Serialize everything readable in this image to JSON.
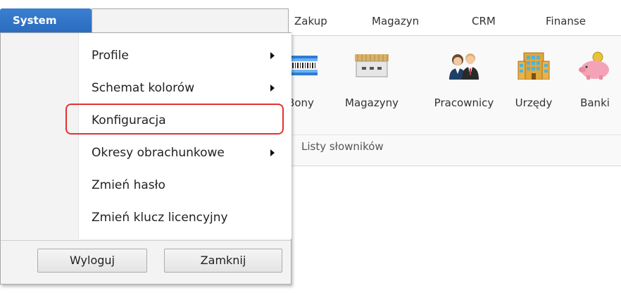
{
  "tabs": [
    {
      "label": "Zakup"
    },
    {
      "label": "Magazyn"
    },
    {
      "label": "CRM"
    },
    {
      "label": "Finanse"
    }
  ],
  "system_tab": {
    "label": "System"
  },
  "menu": {
    "items": [
      {
        "label": "Profile",
        "submenu": true
      },
      {
        "label": "Schemat kolorów",
        "submenu": true
      },
      {
        "label": "Konfiguracja",
        "submenu": false,
        "highlighted": true
      },
      {
        "label": "Okresy obrachunkowe",
        "submenu": true
      },
      {
        "label": "Zmień hasło",
        "submenu": false
      },
      {
        "label": "Zmień klucz licencyjny",
        "submenu": false
      }
    ],
    "logout_label": "Wyloguj",
    "close_label": "Zamknij"
  },
  "ribbon": {
    "buttons": [
      {
        "label": "Bony",
        "icon": "voucher-icon"
      },
      {
        "label": "Magazyny",
        "icon": "warehouse-icon"
      },
      {
        "label": "Pracownicy",
        "icon": "employees-icon"
      },
      {
        "label": "Urzędy",
        "icon": "office-building-icon"
      },
      {
        "label": "Banki",
        "icon": "piggy-bank-icon"
      }
    ],
    "group_label": "Listy słowników"
  },
  "colors": {
    "system_tab": "#2b6cbf",
    "highlight_border": "#e53030"
  }
}
